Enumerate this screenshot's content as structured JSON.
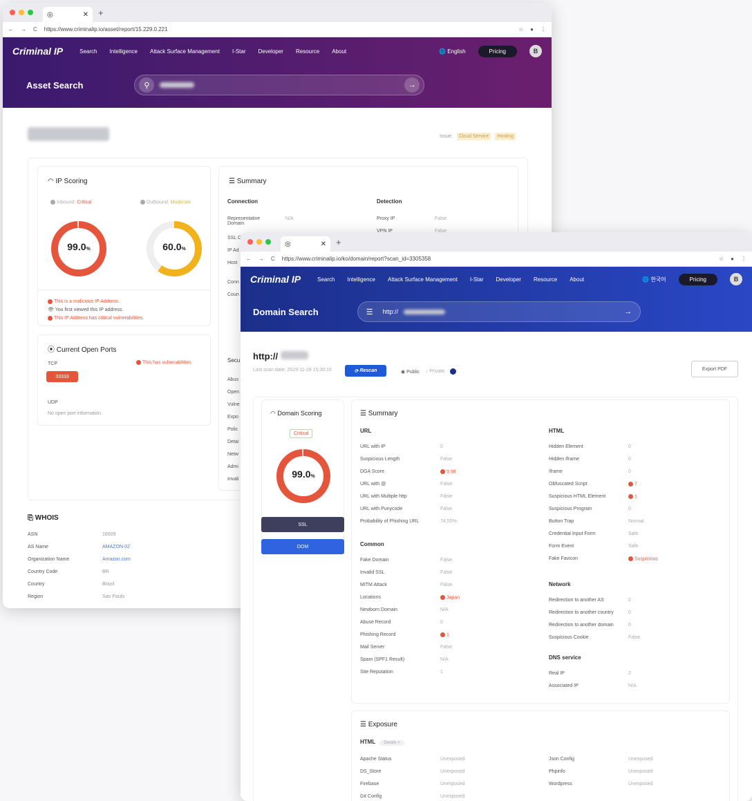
{
  "w1": {
    "url": "https://www.criminalip.io/asset/report/15.229.0.221",
    "logo": "Criminal IP",
    "nav": [
      "Search",
      "Intelligence",
      "Attack Surface Management",
      "I-Star",
      "Developer",
      "Resource",
      "About"
    ],
    "lang": "English",
    "pricing": "Pricing",
    "avatar": "B",
    "title": "Asset Search",
    "issue_label": "Issue:",
    "tags": [
      "Cloud Service",
      "Hosting"
    ],
    "ip_scoring": "IP Scoring",
    "inbound": "Inbound:",
    "inbound_v": "Critical",
    "outbound": "Outbound:",
    "outbound_v": "Moderate",
    "in_score": "99.0",
    "out_score": "60.0",
    "pct": "%",
    "in_level": 0.99,
    "out_level": 0.6,
    "notes": [
      "This is a malicious IP Address.",
      "You first viewed this IP address.",
      "This IP Address has critical vulnerabilities."
    ],
    "summary": "Summary",
    "connection": "Connection",
    "detection": "Detection",
    "rep_domain": "Representative Domain",
    "na": "N/A",
    "proxy": "Proxy IP",
    "false": "False",
    "vpn": "VPN IP",
    "ssl": "SSL C",
    "ipad": "IP Ad",
    "host": "Host",
    "conn": "Conn",
    "coun": "Coun",
    "ports": "Current Open Ports",
    "tcp": "TCP",
    "vuln": "This has vulnerabilities",
    "port_tag": "33333",
    "udp": "UDP",
    "no_port": "No open port information.",
    "secu": "Secu",
    "right_labels": [
      "Abus",
      "Open",
      "Vulne",
      "Expo",
      "Polic",
      "Detai",
      "Netw",
      "Admi",
      "Invali"
    ],
    "whois": "WHOIS",
    "whois_rows": [
      [
        "ASN",
        "16509"
      ],
      [
        "AS Name",
        "AMAZON-02"
      ],
      [
        "Organization Name",
        "Amazon.com"
      ],
      [
        "Country Code",
        "BR"
      ],
      [
        "Country",
        "Brazil"
      ],
      [
        "Region",
        "Sao Paulo"
      ]
    ]
  },
  "w2": {
    "url": "https://www.criminalip.io/ko/domain/report?scan_id=3305358",
    "logo": "Criminal IP",
    "nav": [
      "Search",
      "Intelligence",
      "Attack Surface Management",
      "I-Star",
      "Developer",
      "Resource",
      "About"
    ],
    "lang": "한국어",
    "pricing": "Pricing",
    "avatar": "B",
    "title": "Domain Search",
    "search_val": "http://",
    "scan_title": "http://",
    "last_scan": "Last scan date: 2023-11-28 15:30:15",
    "rescan": "Rescan",
    "public": "Public",
    "private": "Private",
    "export": "Export PDF",
    "domain_scoring": "Domain Scoring",
    "critical": "Critical",
    "score": "99.0",
    "pct": "%",
    "level": 0.99,
    "ssl_btn": "SSL",
    "dom_btn": "DOM",
    "summary": "Summary",
    "url_h": "URL",
    "html_h": "HTML",
    "common_h": "Common",
    "network_h": "Network",
    "dns_h": "DNS service",
    "url_rows": [
      [
        "URL with IP",
        "0"
      ],
      [
        "Suspicious Length",
        "False"
      ],
      [
        "DGA Score",
        "9.98"
      ],
      [
        "URL with @",
        "False"
      ],
      [
        "URL with Multiple http",
        "False"
      ],
      [
        "URL with Punycode",
        "False"
      ],
      [
        "Probability of Phishing URL",
        "74.55%"
      ]
    ],
    "common_rows": [
      [
        "Fake Domain",
        "False"
      ],
      [
        "Invalid SSL",
        "False"
      ],
      [
        "MITM Attack",
        "False"
      ],
      [
        "Locations",
        "Japan"
      ],
      [
        "Newborn Domain",
        "N/A"
      ],
      [
        "Abuse Record",
        "0"
      ],
      [
        "Phishing Record",
        "1"
      ],
      [
        "Mail Server",
        "False"
      ],
      [
        "Spam (SPF1 Result)",
        "N/A"
      ],
      [
        "Site Reputation",
        "1"
      ]
    ],
    "html_rows": [
      [
        "Hidden Element",
        "0"
      ],
      [
        "Hidden Iframe",
        "0"
      ],
      [
        "Iframe",
        "0"
      ],
      [
        "Obfuscated Script",
        "7"
      ],
      [
        "Suspicious HTML Element",
        "1"
      ],
      [
        "Suspicious Program",
        "0"
      ],
      [
        "Button Trap",
        "Normal"
      ],
      [
        "Credential Input Form",
        "Safe"
      ],
      [
        "Form Event",
        "Safe"
      ],
      [
        "Fake Favicon",
        "Suspicious"
      ]
    ],
    "net_rows": [
      [
        "Redirection to another AS",
        "0"
      ],
      [
        "Redirection to another country",
        "0"
      ],
      [
        "Redirection to another domain",
        "0"
      ],
      [
        "Suspicious Cookie",
        "False"
      ]
    ],
    "dns_rows": [
      [
        "Real IP",
        "2"
      ],
      [
        "Associated IP",
        "N/A"
      ]
    ],
    "exposure": "Exposure",
    "html_sub": "HTML",
    "details": "Details",
    "exp_left": [
      [
        "Apache Status",
        "Unexposed"
      ],
      [
        "DS_Store",
        "Unexposed"
      ],
      [
        "Firebase",
        "Unexposed"
      ],
      [
        "Git Config",
        "Unexposed"
      ]
    ],
    "exp_right": [
      [
        "Json Config",
        "Unexposed"
      ],
      [
        "Phpinfo",
        "Unexposed"
      ],
      [
        "Wordpress",
        "Unexposed"
      ]
    ]
  }
}
